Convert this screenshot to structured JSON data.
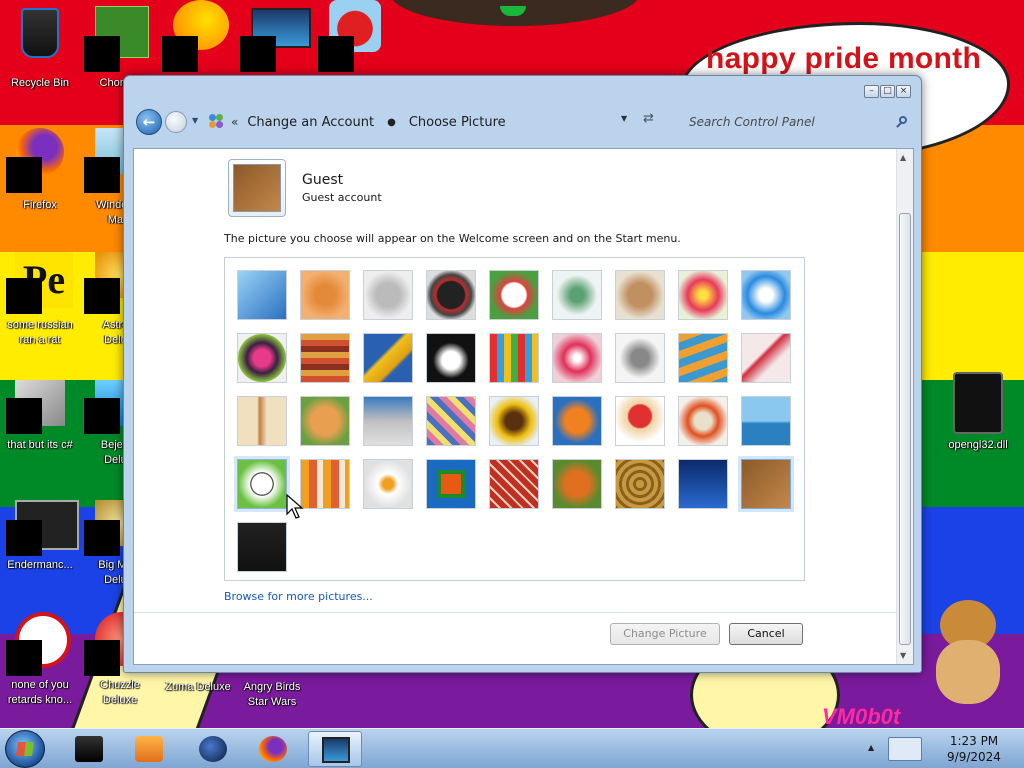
{
  "desktop": {
    "banner_text": "happy pride month",
    "watermark": "VM0b0t",
    "icons": [
      {
        "label": "Recycle Bin"
      },
      {
        "label": "Chomi..."
      },
      {
        "label": "Firefox"
      },
      {
        "label": "Window..."
      },
      {
        "label": "Ma..."
      },
      {
        "label": "some russian"
      },
      {
        "label": "ran a rat"
      },
      {
        "label": "Astro..."
      },
      {
        "label": "Delu..."
      },
      {
        "label": "that but its c#"
      },
      {
        "label": "Bejew..."
      },
      {
        "label": "Delu..."
      },
      {
        "label": "Endermanc..."
      },
      {
        "label": "Big Me..."
      },
      {
        "label": "Delu..."
      },
      {
        "label": "none of you"
      },
      {
        "label": "retards kno..."
      },
      {
        "label": "Chuzzle"
      },
      {
        "label": "Deluxe"
      },
      {
        "label": "Zuma Deluxe"
      },
      {
        "label": "Angry Birds"
      },
      {
        "label": "Star Wars"
      },
      {
        "label": "opengl32.dll"
      }
    ]
  },
  "window": {
    "breadcrumb": [
      "Change an Account",
      "Choose Picture"
    ],
    "search_placeholder": "Search Control Panel",
    "account": {
      "name": "Guest",
      "type": "Guest account"
    },
    "description": "The picture you choose will appear on the Welcome screen and on the Start menu.",
    "pictures": [
      "roller-coaster",
      "starfish",
      "robot-figure",
      "turntable",
      "lucky-cat",
      "gyroscope",
      "kitten",
      "pink-flower",
      "pinwheel",
      "striped-ball",
      "fabric",
      "yellow-leaf",
      "border-collie",
      "crayons",
      "paper-star",
      "jacks",
      "stairs",
      "paper-crane",
      "guitar",
      "pomeranian",
      "toy-robot",
      "scarves",
      "sunflower",
      "fish",
      "hot-air-balloon",
      "daruma",
      "sailboat",
      "soccer-ball",
      "beach-towel",
      "marbles",
      "window",
      "woven-fabric",
      "butterfly",
      "basket",
      "lighthouse",
      "suitcase",
      "laptop-screen"
    ],
    "selected_picture": "suitcase",
    "browse_link": "Browse for more pictures...",
    "buttons": {
      "change": "Change Picture",
      "cancel": "Cancel"
    }
  },
  "taskbar": {
    "items": [
      "terminal",
      "media-player",
      "globe",
      "firefox",
      "display-settings"
    ],
    "clock_time": "1:23 PM",
    "clock_date": "9/9/2024"
  }
}
